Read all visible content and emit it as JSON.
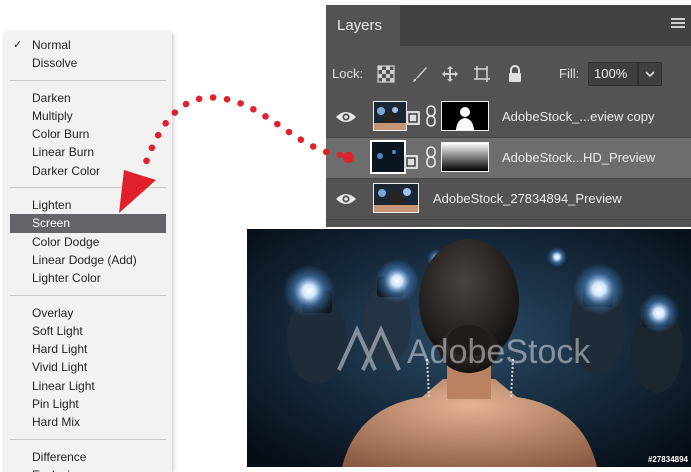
{
  "blend_menu": {
    "groups": [
      [
        {
          "label": "Normal",
          "checked": true
        },
        {
          "label": "Dissolve"
        }
      ],
      [
        {
          "label": "Darken"
        },
        {
          "label": "Multiply"
        },
        {
          "label": "Color Burn"
        },
        {
          "label": "Linear Burn"
        },
        {
          "label": "Darker Color"
        }
      ],
      [
        {
          "label": "Lighten"
        },
        {
          "label": "Screen",
          "selected": true
        },
        {
          "label": "Color Dodge"
        },
        {
          "label": "Linear Dodge (Add)"
        },
        {
          "label": "Lighter Color"
        }
      ],
      [
        {
          "label": "Overlay"
        },
        {
          "label": "Soft Light"
        },
        {
          "label": "Hard Light"
        },
        {
          "label": "Vivid Light"
        },
        {
          "label": "Linear Light"
        },
        {
          "label": "Pin Light"
        },
        {
          "label": "Hard Mix"
        }
      ],
      [
        {
          "label": "Difference"
        },
        {
          "label": "Exclusion"
        }
      ]
    ],
    "check_glyph": "✓"
  },
  "layers_panel": {
    "tab_label": "Layers",
    "lock_label": "Lock:",
    "fill_label": "Fill:",
    "fill_value": "100%",
    "layers": [
      {
        "name": "AdobeStock_...eview copy",
        "visible": true,
        "active": false
      },
      {
        "name": "AdobeStock...HD_Preview",
        "visible": false,
        "active": true
      },
      {
        "name": "AdobeStock_27834894_Preview",
        "visible": true,
        "active": false
      }
    ]
  },
  "photo": {
    "watermark": "AdobeStock",
    "credit": "#27834894"
  },
  "colors": {
    "accent_red": "#e0212c",
    "panel_bg": "#535353",
    "menu_selected": "#636569"
  }
}
